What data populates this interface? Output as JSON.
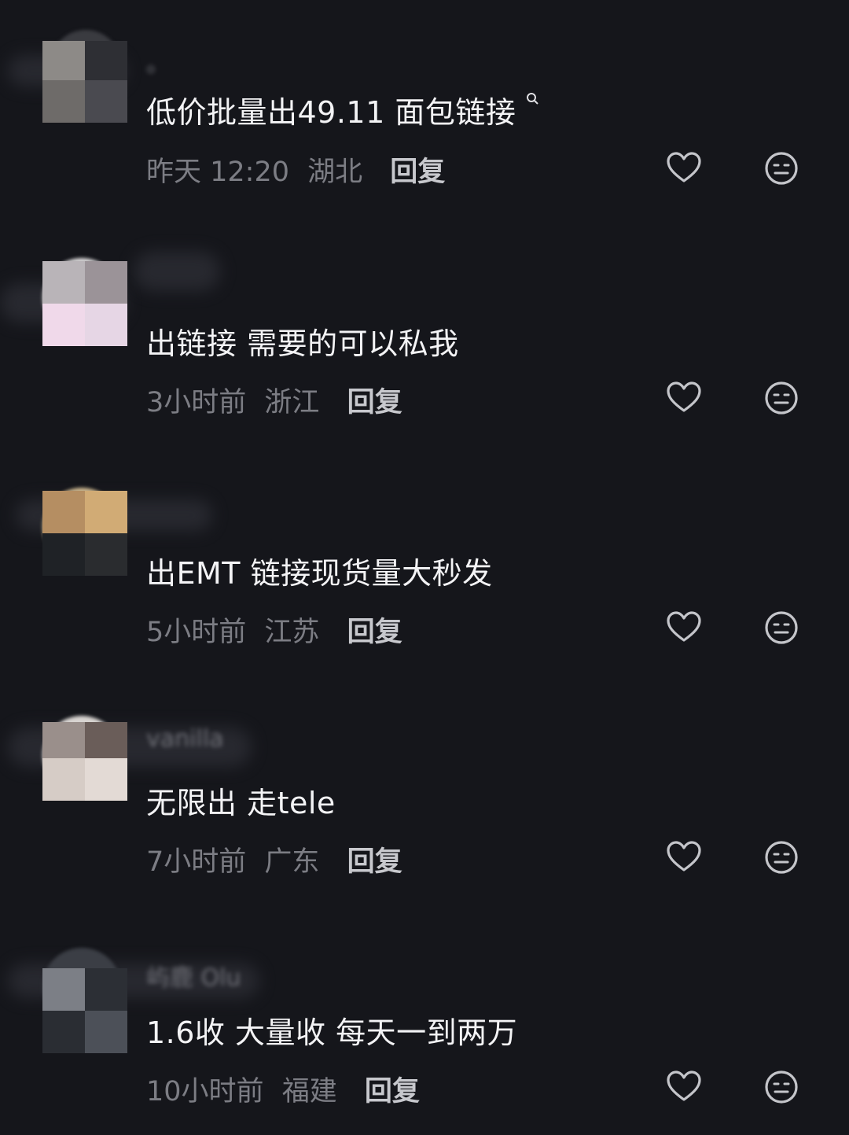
{
  "colors": {
    "background": "#15161b",
    "content_text": "#f3f3f5",
    "meta_text": "#7c7d84",
    "reply_text": "#c7c8cd",
    "icon_stroke": "#c4c5ca"
  },
  "icons": {
    "like": "heart-outline-icon",
    "dislike": "unhappy-face-icon",
    "search": "search-icon"
  },
  "comments": [
    {
      "username": "。",
      "content": "低价批量出49.11 面包链接",
      "time": "昨天 12:20",
      "location": "湖北",
      "reply": "回复"
    },
    {
      "username": "",
      "content": "出链接 需要的可以私我",
      "time": "3小时前",
      "location": "浙江",
      "reply": "回复"
    },
    {
      "username": "",
      "content": "出EMT  链接现货量大秒发",
      "time": "5小时前",
      "location": "江苏",
      "reply": "回复"
    },
    {
      "username": "vanilla",
      "content": "无限出 走tele",
      "time": "7小时前",
      "location": "广东",
      "reply": "回复"
    },
    {
      "username": "屿鹿 Olu",
      "content": "1.6收 大量收 每天一到两万",
      "time": "10小时前",
      "location": "福建",
      "reply": "回复"
    }
  ]
}
